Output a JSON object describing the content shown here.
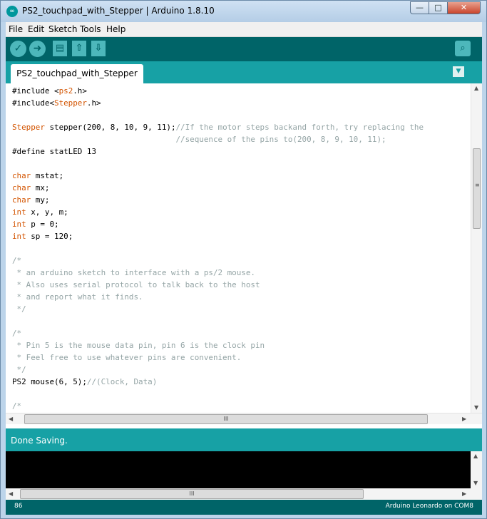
{
  "window": {
    "title": "PS2_touchpad_with_Stepper | Arduino 1.8.10",
    "app_icon": "∞",
    "buttons": {
      "minimize": "—",
      "maximize": "□",
      "close": "✕"
    }
  },
  "menu": [
    "File",
    "Edit",
    "Sketch",
    "Tools",
    "Help"
  ],
  "toolbar": {
    "verify": "✓",
    "upload": "➜",
    "new": "▤",
    "open": "⇧",
    "save": "⇩",
    "serial_monitor": "⌕"
  },
  "tab": {
    "label": "PS2_touchpad_with_Stepper",
    "menu_icon": "▼"
  },
  "code": [
    [
      {
        "t": "#include <"
      },
      {
        "t": "ps2",
        "c": "lib"
      },
      {
        "t": ".h>"
      }
    ],
    [
      {
        "t": "#include<"
      },
      {
        "t": "Stepper",
        "c": "lib"
      },
      {
        "t": ".h>"
      }
    ],
    [],
    [
      {
        "t": "Stepper",
        "c": "kw"
      },
      {
        "t": " stepper(200, 8, 10, 9, 11);"
      },
      {
        "t": "//If the motor steps backand forth, try replacing the",
        "c": "cm"
      }
    ],
    [
      {
        "t": "                                   "
      },
      {
        "t": "//sequence of the pins to(200, 8, 9, 10, 11);",
        "c": "cm"
      }
    ],
    [
      {
        "t": "#define statLED 13"
      }
    ],
    [],
    [
      {
        "t": "char",
        "c": "kw"
      },
      {
        "t": " mstat;"
      }
    ],
    [
      {
        "t": "char",
        "c": "kw"
      },
      {
        "t": " mx;"
      }
    ],
    [
      {
        "t": "char",
        "c": "kw"
      },
      {
        "t": " my;"
      }
    ],
    [
      {
        "t": "int",
        "c": "kw"
      },
      {
        "t": " x, y, m;"
      }
    ],
    [
      {
        "t": "int",
        "c": "kw"
      },
      {
        "t": " p = 0;"
      }
    ],
    [
      {
        "t": "int",
        "c": "kw"
      },
      {
        "t": " sp = 120;"
      }
    ],
    [],
    [
      {
        "t": "/*",
        "c": "cm"
      }
    ],
    [
      {
        "t": " * an arduino sketch to interface with a ps/2 mouse.",
        "c": "cm"
      }
    ],
    [
      {
        "t": " * Also uses serial protocol to talk back to the host",
        "c": "cm"
      }
    ],
    [
      {
        "t": " * and report what it finds.",
        "c": "cm"
      }
    ],
    [
      {
        "t": " */",
        "c": "cm"
      }
    ],
    [],
    [
      {
        "t": "/*",
        "c": "cm"
      }
    ],
    [
      {
        "t": " * Pin 5 is the mouse data pin, pin 6 is the clock pin",
        "c": "cm"
      }
    ],
    [
      {
        "t": " * Feel free to use whatever pins are convenient.",
        "c": "cm"
      }
    ],
    [
      {
        "t": " */",
        "c": "cm"
      }
    ],
    [
      {
        "t": "PS2 mouse(6, 5);"
      },
      {
        "t": "//(Clock, Data)",
        "c": "cm"
      }
    ],
    [],
    [
      {
        "t": "/*",
        "c": "cm"
      }
    ]
  ],
  "scroll": {
    "grip": "≡",
    "hgrip": "III",
    "up": "▲",
    "down": "▼",
    "left": "◀",
    "right": "▶"
  },
  "status": {
    "message": "Done Saving."
  },
  "footer": {
    "line": "86",
    "board": "Arduino Leonardo on COM8"
  }
}
